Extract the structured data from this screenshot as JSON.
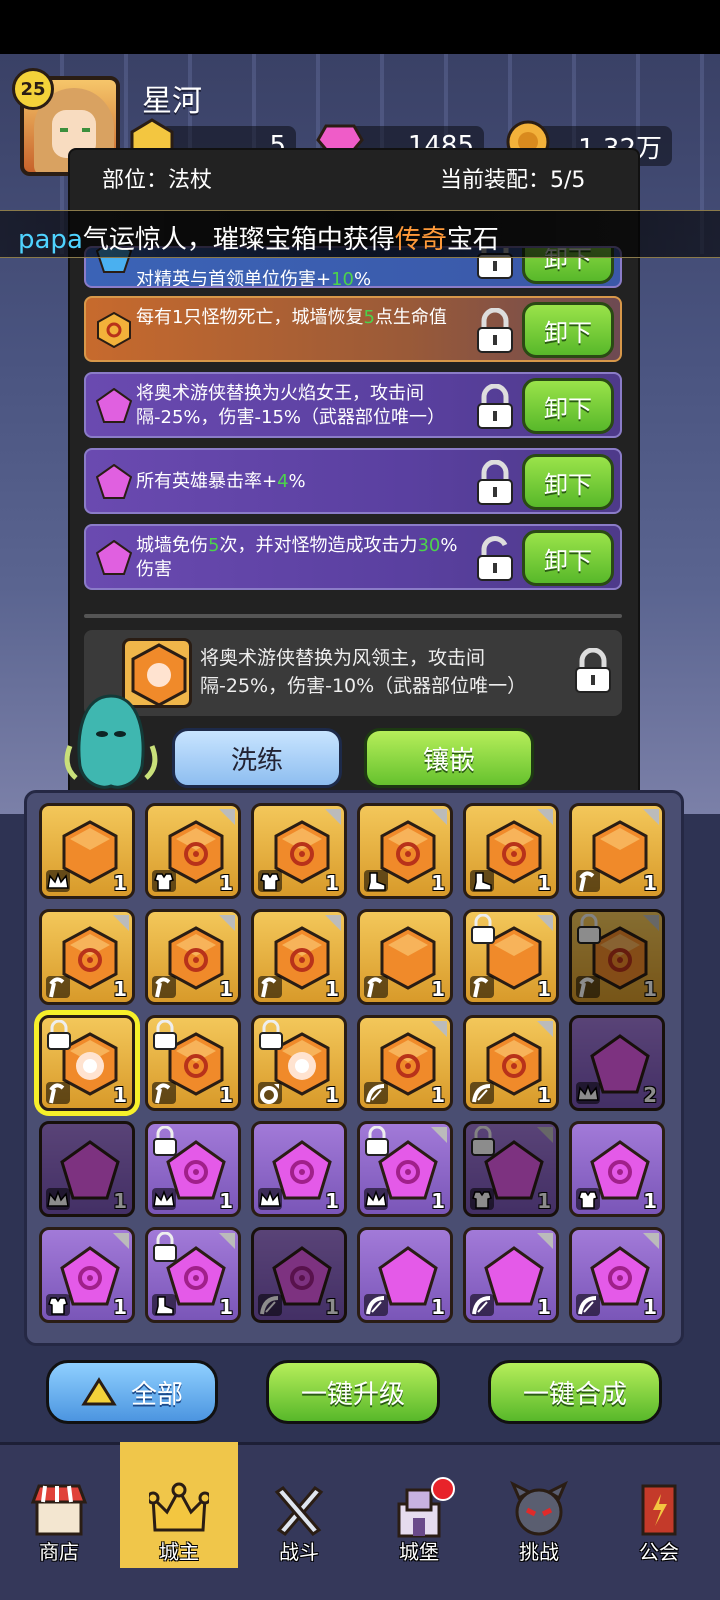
{
  "header": {
    "level": "25",
    "player_name": "星河",
    "resources": [
      {
        "icon": "gold-gem-icon",
        "value": "5"
      },
      {
        "icon": "pink-diamond-icon",
        "value": "1485"
      },
      {
        "icon": "coin-icon",
        "value": "1.32万"
      }
    ]
  },
  "banner": {
    "prefix": "papa",
    "text_a": "气运惊人，璀璨宝箱中获得",
    "highlight": "传奇",
    "text_b": "宝石"
  },
  "panel": {
    "slot_label": "部位：法杖",
    "current_label": "当前装配：5/5",
    "rows": [
      {
        "text": "对精英与首领单位伤害+",
        "value": "10",
        "tail": "%",
        "lock": "locked",
        "button": "卸下",
        "color": "blue"
      },
      {
        "text": "每有1只怪物死亡，城墙恢复",
        "value": "5",
        "tail": "点生命值",
        "lock": "locked",
        "button": "卸下",
        "color": "orange"
      },
      {
        "text": "将奥术游侠替换为火焰女王，攻击间隔-25%，伤害-15%（武器部位唯一）",
        "value": "",
        "tail": "",
        "lock": "locked",
        "button": "卸下",
        "color": "purple"
      },
      {
        "text": "所有英雄暴击率+",
        "value": "4",
        "tail": "%",
        "lock": "locked",
        "button": "卸下",
        "color": "purple"
      },
      {
        "text": "城墙免伤",
        "value": "5",
        "tail": "次，并对怪物造成攻击力",
        "value2": "30",
        "tail2": "%伤害",
        "lock": "unlocked",
        "button": "卸下",
        "color": "purple"
      }
    ],
    "new_gem_text": "将奥术游侠替换为风领主，攻击间隔-25%，伤害-10%（武器部位唯一）",
    "refine_button": "洗练",
    "inlay_button": "镶嵌"
  },
  "inventory": [
    [
      {
        "type": "gold",
        "gem": "hex",
        "part": "crown-icon",
        "count": "1",
        "locked": false,
        "dim": false,
        "corner": false
      },
      {
        "type": "gold",
        "gem": "hex-swirl",
        "part": "armor-icon",
        "count": "1",
        "locked": false,
        "dim": false,
        "corner": true
      },
      {
        "type": "gold",
        "gem": "hex-swirl",
        "part": "armor-icon",
        "count": "1",
        "locked": false,
        "dim": false,
        "corner": true
      },
      {
        "type": "gold",
        "gem": "hex-swirl",
        "part": "boot-icon",
        "count": "1",
        "locked": false,
        "dim": false,
        "corner": true
      },
      {
        "type": "gold",
        "gem": "hex-swirl",
        "part": "boot-icon",
        "count": "1",
        "locked": false,
        "dim": false,
        "corner": true
      },
      {
        "type": "gold",
        "gem": "hex",
        "part": "staff-icon",
        "count": "1",
        "locked": false,
        "dim": false,
        "corner": true
      }
    ],
    [
      {
        "type": "gold",
        "gem": "hex-swirl",
        "part": "staff-icon",
        "count": "1",
        "locked": false,
        "dim": false,
        "corner": true
      },
      {
        "type": "gold",
        "gem": "hex-swirl",
        "part": "staff-icon",
        "count": "1",
        "locked": false,
        "dim": false,
        "corner": true
      },
      {
        "type": "gold",
        "gem": "hex-swirl",
        "part": "staff-icon",
        "count": "1",
        "locked": false,
        "dim": false,
        "corner": true
      },
      {
        "type": "gold",
        "gem": "hex",
        "part": "staff-icon",
        "count": "1",
        "locked": false,
        "dim": false,
        "corner": false
      },
      {
        "type": "gold",
        "gem": "hex",
        "part": "staff-icon",
        "count": "1",
        "locked": true,
        "dim": false,
        "corner": true
      },
      {
        "type": "gold",
        "gem": "hex-swirl",
        "part": "staff-icon",
        "count": "1",
        "locked": true,
        "dim": true,
        "corner": true
      }
    ],
    [
      {
        "type": "gold",
        "gem": "hex-star",
        "part": "staff-icon",
        "count": "1",
        "locked": true,
        "dim": false,
        "corner": false,
        "selected": true
      },
      {
        "type": "gold",
        "gem": "hex-swirl",
        "part": "staff-icon",
        "count": "1",
        "locked": true,
        "dim": false,
        "corner": false
      },
      {
        "type": "gold",
        "gem": "hex-star",
        "part": "ring-icon",
        "count": "1",
        "locked": true,
        "dim": false,
        "corner": false
      },
      {
        "type": "gold",
        "gem": "hex-swirl",
        "part": "bow-icon",
        "count": "1",
        "locked": false,
        "dim": false,
        "corner": true
      },
      {
        "type": "gold",
        "gem": "hex-swirl",
        "part": "bow-icon",
        "count": "1",
        "locked": false,
        "dim": false,
        "corner": true
      },
      {
        "type": "violet",
        "gem": "pent",
        "part": "crown-icon",
        "count": "2",
        "locked": false,
        "dim": true,
        "corner": false
      }
    ],
    [
      {
        "type": "violet",
        "gem": "pent",
        "part": "crown-icon",
        "count": "1",
        "locked": false,
        "dim": true,
        "corner": false
      },
      {
        "type": "violet",
        "gem": "pent-swirl",
        "part": "crown-icon",
        "count": "1",
        "locked": true,
        "dim": false,
        "corner": false
      },
      {
        "type": "violet",
        "gem": "pent-swirl",
        "part": "crown-icon",
        "count": "1",
        "locked": false,
        "dim": false,
        "corner": false
      },
      {
        "type": "violet",
        "gem": "pent-swirl",
        "part": "crown-icon",
        "count": "1",
        "locked": true,
        "dim": false,
        "corner": true
      },
      {
        "type": "violet",
        "gem": "pent",
        "part": "armor-icon",
        "count": "1",
        "locked": true,
        "dim": true,
        "corner": true
      },
      {
        "type": "violet",
        "gem": "pent-swirl",
        "part": "armor-icon",
        "count": "1",
        "locked": false,
        "dim": false,
        "corner": false
      }
    ],
    [
      {
        "type": "violet",
        "gem": "pent-swirl",
        "part": "armor-icon",
        "count": "1",
        "locked": false,
        "dim": false,
        "corner": true
      },
      {
        "type": "violet",
        "gem": "pent-swirl",
        "part": "boot-icon",
        "count": "1",
        "locked": true,
        "dim": false,
        "corner": true
      },
      {
        "type": "violet",
        "gem": "pent-swirl",
        "part": "bow-icon",
        "count": "1",
        "locked": false,
        "dim": true,
        "corner": false
      },
      {
        "type": "violet",
        "gem": "pent",
        "part": "bow-icon",
        "count": "1",
        "locked": false,
        "dim": false,
        "corner": false
      },
      {
        "type": "violet",
        "gem": "pent",
        "part": "bow-icon",
        "count": "1",
        "locked": false,
        "dim": false,
        "corner": true
      },
      {
        "type": "violet",
        "gem": "pent-swirl",
        "part": "bow-icon",
        "count": "1",
        "locked": false,
        "dim": false,
        "corner": true
      }
    ]
  ],
  "actions": {
    "filter_label": "全部",
    "upgrade_all": "一键升级",
    "merge_all": "一键合成"
  },
  "nav": [
    {
      "label": "商店",
      "icon": "shop-icon",
      "active": false
    },
    {
      "label": "城主",
      "icon": "crown-icon",
      "active": true
    },
    {
      "label": "战斗",
      "icon": "crossed-swords-icon",
      "active": false
    },
    {
      "label": "城堡",
      "icon": "castle-icon",
      "active": false,
      "badge": true
    },
    {
      "label": "挑战",
      "icon": "demon-icon",
      "active": false
    },
    {
      "label": "公会",
      "icon": "banner-icon",
      "active": false
    }
  ],
  "colors": {
    "gold_slot": "#f3c75a",
    "violet_slot": "#a27ad8",
    "accent_green": "#58b82a",
    "highlight": "#ff9a3a"
  }
}
